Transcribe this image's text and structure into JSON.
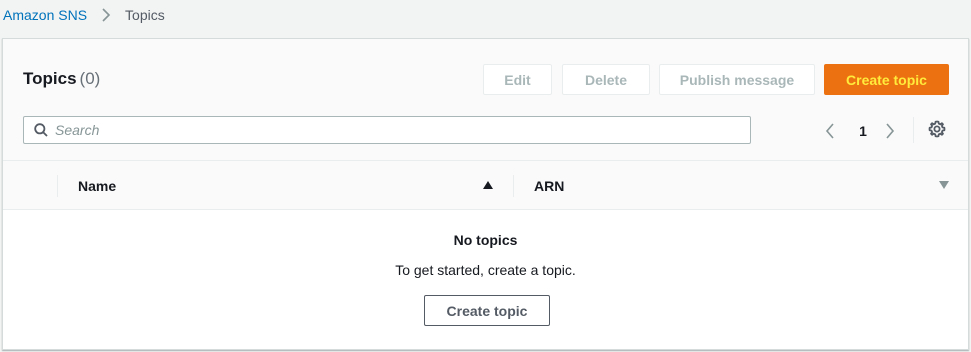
{
  "breadcrumb": {
    "service": "Amazon SNS",
    "current": "Topics"
  },
  "header": {
    "title": "Topics",
    "count": "(0)"
  },
  "actions": {
    "edit": "Edit",
    "delete": "Delete",
    "publish": "Publish message",
    "create": "Create topic"
  },
  "search": {
    "placeholder": "Search",
    "value": ""
  },
  "pagination": {
    "current_page": "1"
  },
  "table": {
    "columns": [
      {
        "label": "Name",
        "sort": "ascending"
      },
      {
        "label": "ARN",
        "sort": "none"
      }
    ]
  },
  "empty_state": {
    "title": "No topics",
    "message": "To get started, create a topic.",
    "button": "Create topic"
  },
  "colors": {
    "accent": "#ec7211",
    "link": "#0073bb",
    "disabled_text": "#aab7b8"
  }
}
